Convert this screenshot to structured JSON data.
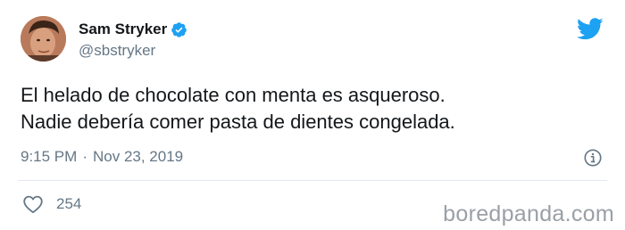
{
  "user": {
    "display_name": "Sam Stryker",
    "handle": "@sbstryker"
  },
  "tweet": {
    "lines": [
      "El helado de chocolate con menta es asqueroso.",
      "Nadie debería comer pasta de dientes congelada."
    ],
    "time": "9:15 PM",
    "separator": "·",
    "date": "Nov 23, 2019"
  },
  "engagement": {
    "likes": "254"
  },
  "watermark": "boredpanda.com",
  "icons": {
    "verified": "verified-badge-icon",
    "brand": "twitter-bird-icon",
    "info": "info-icon",
    "like": "heart-icon"
  },
  "colors": {
    "twitter_blue": "#1da1f2",
    "text": "#14171a",
    "secondary_text": "#657786",
    "divider": "#e1e8ed"
  }
}
